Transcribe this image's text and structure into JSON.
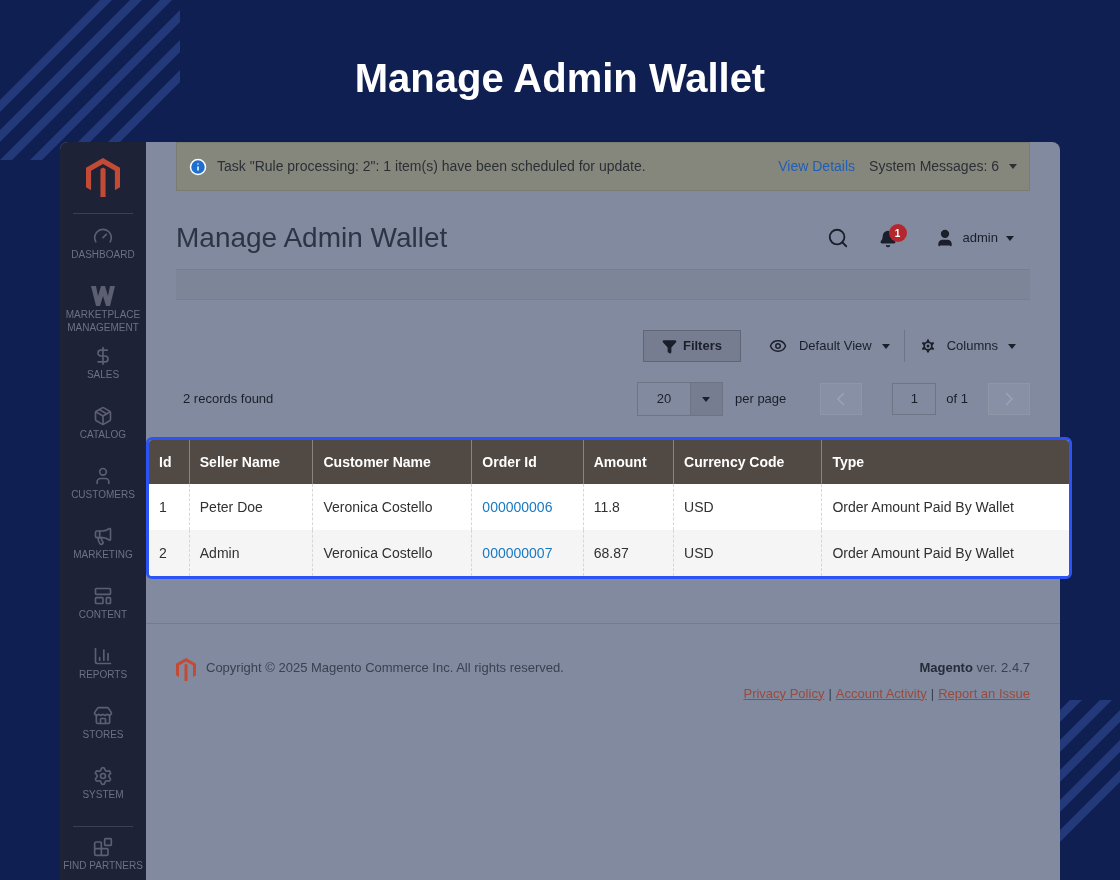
{
  "heading": "Manage Admin Wallet",
  "sidebar": {
    "items": [
      {
        "label": "DASHBOARD"
      },
      {
        "label": "MARKETPLACE MANAGEMENT"
      },
      {
        "label": "SALES"
      },
      {
        "label": "CATALOG"
      },
      {
        "label": "CUSTOMERS"
      },
      {
        "label": "MARKETING"
      },
      {
        "label": "CONTENT"
      },
      {
        "label": "REPORTS"
      },
      {
        "label": "STORES"
      },
      {
        "label": "SYSTEM"
      },
      {
        "label": "FIND PARTNERS"
      }
    ]
  },
  "message_bar": {
    "text": "Task \"Rule processing: 2\": 1 item(s) have been scheduled for update.",
    "link": "View Details",
    "system_messages": "System Messages: 6"
  },
  "page_title": "Manage Admin Wallet",
  "header": {
    "notifications": "1",
    "user": "admin"
  },
  "toolbar": {
    "filters": "Filters",
    "view": "Default View",
    "columns": "Columns"
  },
  "records": "2 records found",
  "pager": {
    "per_page_value": "20",
    "per_page_label": "per page",
    "page": "1",
    "of": "of 1",
    "prev_disabled": true,
    "next_disabled": true
  },
  "table": {
    "columns": [
      {
        "label": "Id",
        "kind": "text"
      },
      {
        "label": "Seller Name",
        "kind": "text"
      },
      {
        "label": "Customer Name",
        "kind": "text"
      },
      {
        "label": "Order Id",
        "kind": "link"
      },
      {
        "label": "Amount",
        "kind": "text"
      },
      {
        "label": "Currency Code",
        "kind": "text"
      },
      {
        "label": "Type",
        "kind": "text"
      }
    ],
    "rows": [
      [
        "1",
        "Peter Doe",
        "Veronica Costello",
        "000000006",
        "11.8",
        "USD",
        "Order Amount Paid By Wallet"
      ],
      [
        "2",
        "Admin",
        "Veronica Costello",
        "000000007",
        "68.87",
        "USD",
        "Order Amount Paid By Wallet"
      ]
    ]
  },
  "footer": {
    "copyright": "Copyright © 2025 Magento Commerce Inc. All rights reserved.",
    "brand": "Magento",
    "version": "ver. 2.4.7",
    "links": [
      "Privacy Policy",
      "Account Activity",
      "Report an Issue"
    ],
    "separator": "|"
  }
}
